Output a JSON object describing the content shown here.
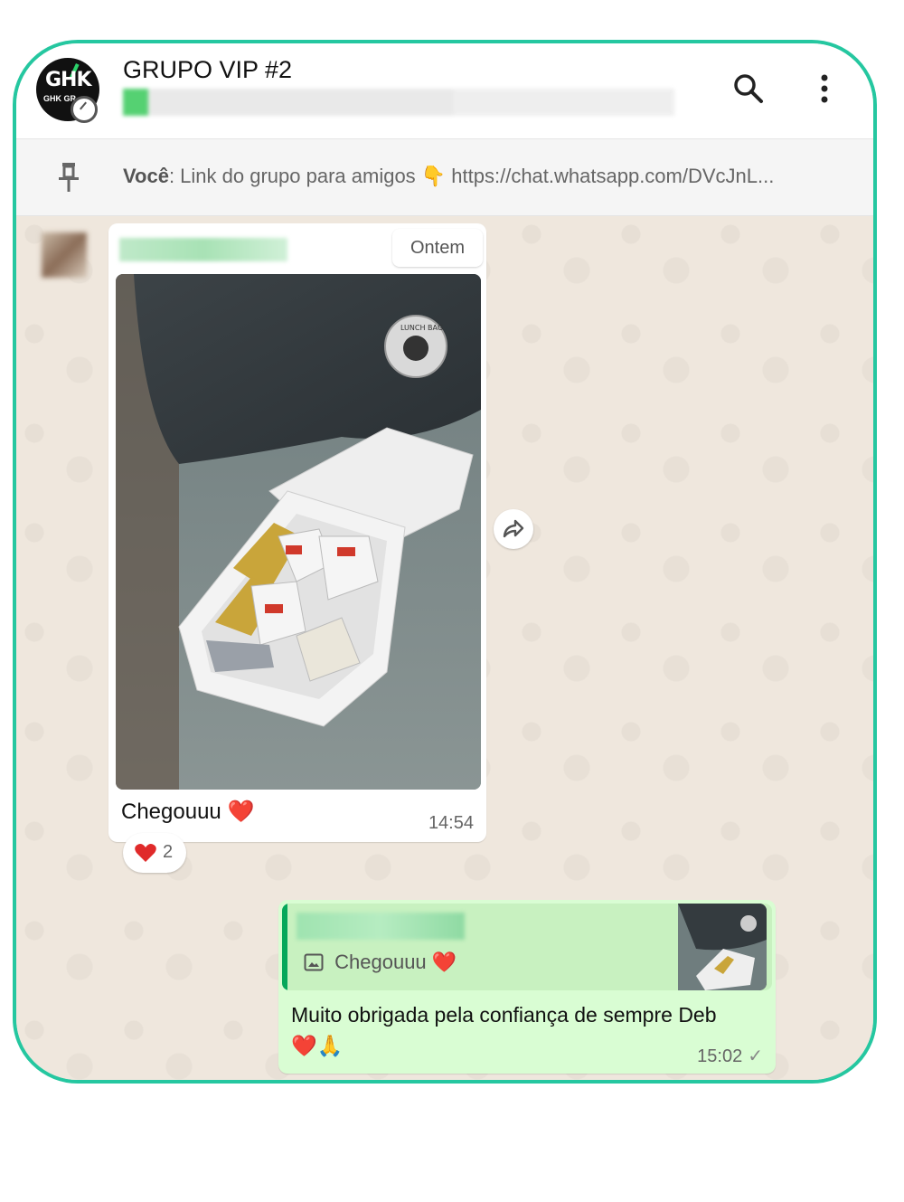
{
  "header": {
    "title": "GRUPO VIP #2",
    "avatar_logo_text": "GHK",
    "avatar_logo_subtext": "GHK GR"
  },
  "pinned": {
    "sender": "Você",
    "text": ": Link do grupo para amigos 👇 https://chat.whatsapp.com/DVcJnL..."
  },
  "incoming": {
    "date_chip": "Ontem",
    "caption": "Chegouuu",
    "caption_emoji": "❤️",
    "time": "14:54",
    "reaction_count": "2",
    "image_label_text": "LUNCH BAG"
  },
  "outgoing": {
    "quote_text": "Chegouuu",
    "quote_emoji": "❤️",
    "message": "Muito obrigada pela confiança de sempre Deb",
    "message_emojis": "❤️🙏",
    "time": "15:02",
    "status": "✓"
  },
  "colors": {
    "accent": "#25c7a0",
    "outgoing_bubble": "#d9fdd3",
    "chat_bg": "#efe7dd"
  }
}
